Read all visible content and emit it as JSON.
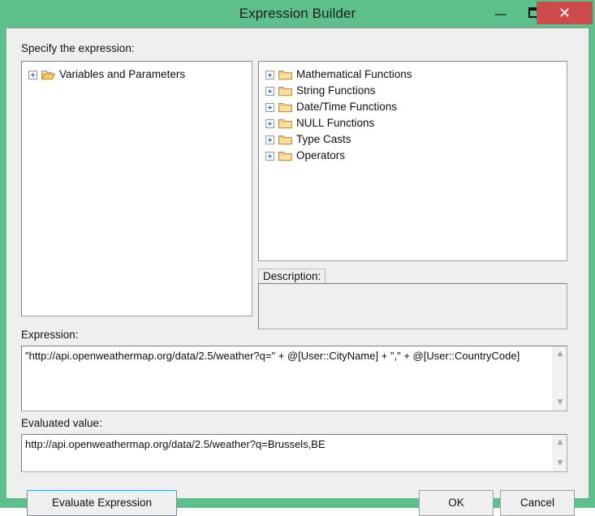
{
  "window": {
    "title": "Expression Builder",
    "controls": {
      "minimize": "minimize",
      "maximize": "maximize",
      "close": "✕"
    },
    "colors": {
      "titlebar": "#5cbf8c",
      "close_button": "#ce4b4b",
      "client_background": "#efefef",
      "focus_border": "#3f9fe0",
      "folder_icon": "#f0c065"
    }
  },
  "left_panel": {
    "label": "Specify the expression:",
    "tree": [
      {
        "label": "Variables and Parameters",
        "icon": "folder-open-icon",
        "expander": "plus-icon"
      }
    ]
  },
  "right_panel": {
    "tree": [
      {
        "label": "Mathematical Functions",
        "icon": "folder-closed-icon",
        "expander": "plus-icon"
      },
      {
        "label": "String Functions",
        "icon": "folder-closed-icon",
        "expander": "plus-icon"
      },
      {
        "label": "Date/Time Functions",
        "icon": "folder-closed-icon",
        "expander": "plus-icon"
      },
      {
        "label": "NULL Functions",
        "icon": "folder-closed-icon",
        "expander": "plus-icon"
      },
      {
        "label": "Type Casts",
        "icon": "folder-closed-icon",
        "expander": "plus-icon"
      },
      {
        "label": "Operators",
        "icon": "folder-closed-icon",
        "expander": "plus-icon"
      }
    ]
  },
  "description": {
    "label": "Description:",
    "value": ""
  },
  "expression": {
    "label": "Expression:",
    "value": "\"http://api.openweathermap.org/data/2.5/weather?q=\" + @[User::CityName] + \",\" +  @[User::CountryCode]",
    "scroll_up": "▲",
    "scroll_down": "▼"
  },
  "evaluated_value": {
    "label": "Evaluated value:",
    "value": "http://api.openweathermap.org/data/2.5/weather?q=Brussels,BE",
    "scroll_up": "▲",
    "scroll_down": "▼"
  },
  "buttons": {
    "evaluate": "Evaluate Expression",
    "ok": "OK",
    "cancel": "Cancel"
  }
}
